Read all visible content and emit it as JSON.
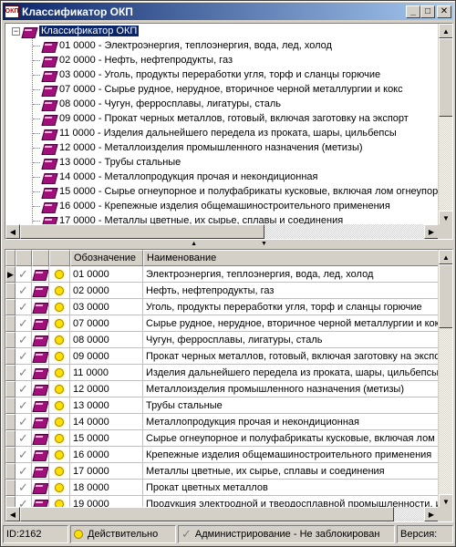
{
  "window": {
    "title": "Классификатор ОКП",
    "icon_text": "ОКП"
  },
  "tree": {
    "root": "Классификатор ОКП",
    "items": [
      "01 0000 - Электроэнергия, теплоэнергия, вода, лед, холод",
      "02 0000 - Нефть, нефтепродукты, газ",
      "03 0000 - Уголь, продукты переработки угля, торф и сланцы горючие",
      "07 0000 - Сырье рудное, нерудное, вторичное черной металлургии и кокс",
      "08 0000 - Чугун, ферросплавы, лигатуры, сталь",
      "09 0000 - Прокат черных металлов, готовый, включая заготовку на экспорт",
      "11 0000 - Изделия дальнейшего передела из проката, шары, цильбепсы",
      "12 0000 - Металлоизделия промышленного назначения (метизы)",
      "13 0000 - Трубы стальные",
      "14 0000 - Металлопродукция прочая и некондиционная",
      "15 0000 - Сырье огнеупорное и полуфабрикаты кусковые, включая лом огнеупор",
      "16 0000 - Крепежные изделия общемашиностроительного применения",
      "17 0000 - Металлы цветные, их сырье, сплавы и соединения"
    ]
  },
  "grid": {
    "columns": {
      "code": "Обозначение",
      "name": "Наименование"
    },
    "rows": [
      {
        "code": "01 0000",
        "name": "Электроэнергия, теплоэнергия, вода, лед, холод"
      },
      {
        "code": "02 0000",
        "name": "Нефть, нефтепродукты, газ"
      },
      {
        "code": "03 0000",
        "name": "Уголь, продукты переработки угля, торф и сланцы горючие"
      },
      {
        "code": "07 0000",
        "name": "Сырье рудное, нерудное, вторичное черной металлургии и кок"
      },
      {
        "code": "08 0000",
        "name": "Чугун, ферросплавы, лигатуры, сталь"
      },
      {
        "code": "09 0000",
        "name": "Прокат черных металлов, готовый, включая заготовку на экспо"
      },
      {
        "code": "11 0000",
        "name": "Изделия дальнейшего передела из проката, шары, цильбепсы"
      },
      {
        "code": "12 0000",
        "name": "Металлоизделия промышленного назначения (метизы)"
      },
      {
        "code": "13 0000",
        "name": "Трубы стальные"
      },
      {
        "code": "14 0000",
        "name": "Металлопродукция прочая и некондиционная"
      },
      {
        "code": "15 0000",
        "name": "Сырье огнеупорное и полуфабрикаты кусковые, включая лом"
      },
      {
        "code": "16 0000",
        "name": "Крепежные изделия общемашиностроительного применения"
      },
      {
        "code": "17 0000",
        "name": "Металлы цветные, их сырье, сплавы и соединения"
      },
      {
        "code": "18 0000",
        "name": "Прокат цветных металлов"
      },
      {
        "code": "19 0000",
        "name": "Продукция электродной и твердосплавной промышленности, и"
      }
    ]
  },
  "statusbar": {
    "id": "ID:2162",
    "state": "Действительно",
    "admin": "Администрирование - Не заблокирован",
    "version": "Версия:"
  },
  "colors": {
    "title_bg": "#0a246a",
    "book": "#a0107a",
    "status_sun": "#ffe000"
  }
}
